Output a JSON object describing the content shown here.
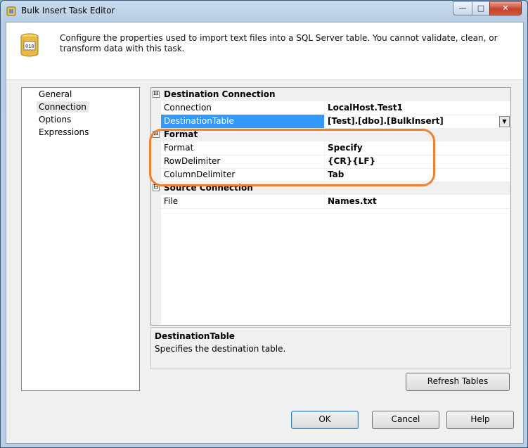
{
  "window": {
    "title": "Bulk Insert Task Editor",
    "minimize_glyph": "—",
    "maximize_glyph": "□",
    "close_glyph": "✕"
  },
  "header": {
    "description": "Configure the properties used to import text files into a SQL Server table. You cannot validate, clean, or transform data with this task."
  },
  "nav": {
    "items": [
      {
        "label": "General"
      },
      {
        "label": "Connection",
        "selected": true
      },
      {
        "label": "Options"
      },
      {
        "label": "Expressions"
      }
    ]
  },
  "properties": {
    "categories": [
      {
        "name": "Destination Connection",
        "expander": "⊟",
        "rows": [
          {
            "label": "Connection",
            "value": "LocalHost.Test1"
          },
          {
            "label": "DestinationTable",
            "value": "[Test].[dbo].[BulkInsert]",
            "selected": true
          }
        ]
      },
      {
        "name": "Format",
        "expander": "⊟",
        "rows": [
          {
            "label": "Format",
            "value": "Specify"
          },
          {
            "label": "RowDelimiter",
            "value": "{CR}{LF}"
          },
          {
            "label": "ColumnDelimiter",
            "value": "Tab"
          }
        ]
      },
      {
        "name": "Source Connection",
        "expander": "⊟",
        "rows": [
          {
            "label": "File",
            "value": "Names.txt"
          }
        ]
      }
    ],
    "dropdown_glyph": "▼"
  },
  "help": {
    "title": "DestinationTable",
    "text": "Specifies the destination table."
  },
  "buttons": {
    "refresh": "Refresh Tables",
    "ok": "OK",
    "cancel": "Cancel",
    "help": "Help"
  },
  "colors": {
    "selection": "#3399ff",
    "annotation": "#f08030"
  }
}
